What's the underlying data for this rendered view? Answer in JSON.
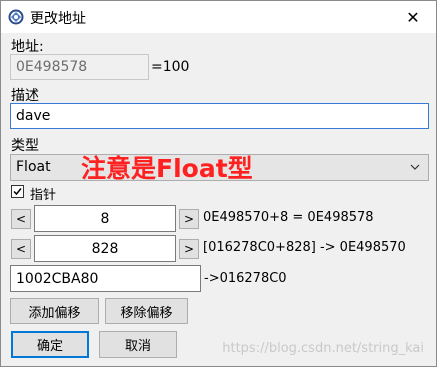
{
  "window": {
    "title": "更改地址",
    "close_glyph": "✕",
    "icon": "cheat-engine-icon"
  },
  "address": {
    "label": "地址:",
    "value": "0E498578",
    "result": "=100"
  },
  "description": {
    "label": "描述",
    "value": "dave"
  },
  "type": {
    "label": "类型",
    "value": "Float",
    "annotation": "注意是Float型"
  },
  "pointer": {
    "checkbox_label": "指针",
    "checked": true,
    "check_glyph": "✓",
    "decrement_glyph": "<",
    "increment_glyph": ">",
    "offsets": [
      {
        "value": "8",
        "info": "0E498570+8 = 0E498578"
      },
      {
        "value": "828",
        "info": "[016278C0+828] -> 0E498570"
      }
    ],
    "base": {
      "value": "1002CBA80",
      "info": "->016278C0"
    }
  },
  "buttons": {
    "add_offset": "添加偏移",
    "remove_offset": "移除偏移",
    "ok": "确定",
    "cancel": "取消"
  },
  "watermark": "https://blog.csdn.net/string_kai"
}
